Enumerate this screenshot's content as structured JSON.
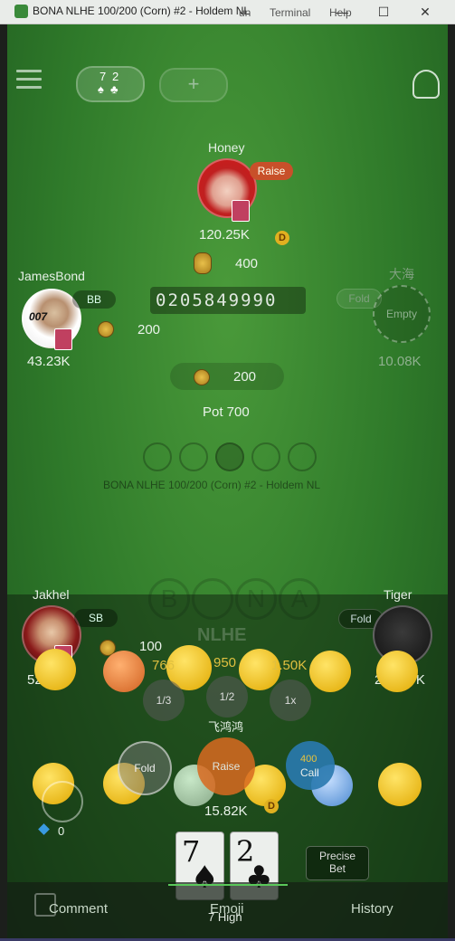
{
  "window": {
    "title": "BONA NLHE 100/200 (Corn) #2 - Holdem NL",
    "menu_run": "un",
    "menu_terminal": "Terminal",
    "menu_help": "Help",
    "min": "—",
    "max": "☐",
    "close": "✕"
  },
  "header": {
    "cards_badge_1": "7",
    "cards_badge_2": "2",
    "add_icon": "+"
  },
  "players": {
    "honey": {
      "name": "Honey",
      "action": "Raise",
      "stack": "120.25K",
      "bet": "400"
    },
    "james": {
      "name": "JamesBond",
      "badge": "BB",
      "stack": "43.23K",
      "bet": "200"
    },
    "dahai": {
      "name": "大海",
      "badge": "Fold",
      "seat": "Empty",
      "stack": "10.08K"
    },
    "jakhel": {
      "name": "Jakhel",
      "badge": "SB",
      "stack": "52.93K",
      "bet": "100"
    },
    "tiger": {
      "name": "Tiger",
      "badge": "Fold",
      "stack": "207.87K"
    },
    "hero": {
      "name": "飞鸿鸿",
      "stack": "15.82K"
    }
  },
  "table": {
    "counter": "0205849990",
    "center_bet": "200",
    "pot": "Pot 700",
    "table_name": "BONA NLHE 100/200 (Corn) #2 - Holdem NL",
    "logo_b": "B",
    "logo_n": "N",
    "logo_a": "A",
    "logo_sub": "NLHE"
  },
  "betting": {
    "third": "1/3",
    "half": "1/2",
    "full": "1x",
    "val_766": "766",
    "val_950": "950",
    "val_150k": "1.50K",
    "fold": "Fold",
    "raise": "Raise",
    "call": "Call",
    "call_amt": "400",
    "precise": "Precise",
    "bet": "Bet",
    "diamonds": "0"
  },
  "hero_cards": [
    {
      "rank": "7",
      "suit": "♠"
    },
    {
      "rank": "2",
      "suit": "♣"
    }
  ],
  "hand_label": "7 High",
  "bottom": {
    "comment": "Comment",
    "emoji": "Emoji",
    "history": "History"
  },
  "dealer_mark": "D",
  "colors": {
    "felt": "#2f7a2a",
    "raise_badge": "#c8502a",
    "call_btn": "#2a7ab0",
    "raise_btn": "#d96a20"
  }
}
